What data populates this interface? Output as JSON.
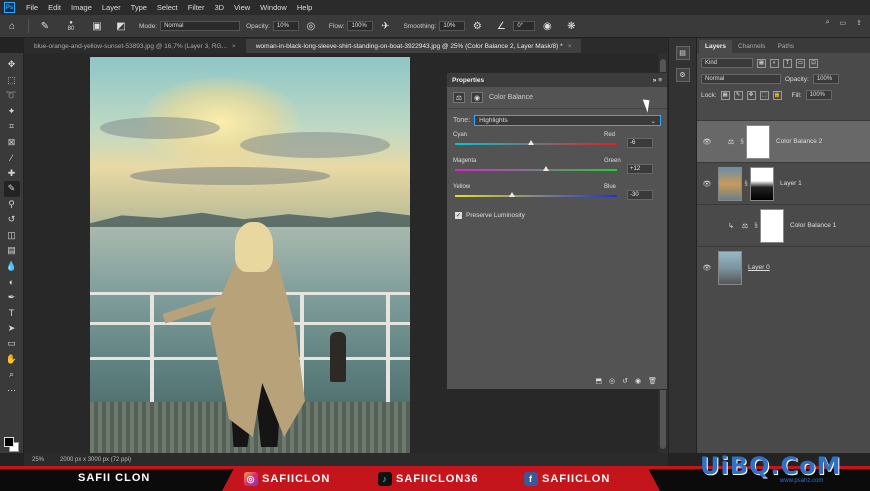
{
  "menu": [
    "File",
    "Edit",
    "Image",
    "Layer",
    "Type",
    "Select",
    "Filter",
    "3D",
    "View",
    "Window",
    "Help"
  ],
  "options": {
    "brush_size": "80",
    "mode_label": "Mode:",
    "mode_value": "Normal",
    "opacity_label": "Opacity:",
    "opacity_value": "10%",
    "flow_label": "Flow:",
    "flow_value": "100%",
    "smoothing_label": "Smoothing:",
    "smoothing_value": "10%",
    "angle_value": "0°"
  },
  "tabs": [
    {
      "label": "blue-orange-and-yellow-sunset-53893.jpg @ 16,7% (Layer 3, RG...",
      "active": false
    },
    {
      "label": "woman-in-black-long-sleeve-shirt-standing-on-boat-3922943.jpg @ 25% (Color Balance 2, Layer Mask/8) *",
      "active": true
    }
  ],
  "properties": {
    "panel_title": "Properties",
    "adjustment_name": "Color Balance",
    "tone_label": "Tone:",
    "tone_value": "Highlights",
    "sliders": [
      {
        "left": "Cyan",
        "right": "Red",
        "value": "-6",
        "position": 0.47
      },
      {
        "left": "Magenta",
        "right": "Green",
        "value": "+12",
        "position": 0.56
      },
      {
        "left": "Yellow",
        "right": "Blue",
        "value": "-30",
        "position": 0.35
      }
    ],
    "preserve_label": "Preserve Luminosity"
  },
  "layers_panel": {
    "tabs": [
      "Layers",
      "Channels",
      "Paths"
    ],
    "filter_value": "Kind",
    "blend_value": "Normal",
    "opacity_label": "Opacity:",
    "opacity_value": "100%",
    "lock_label": "Lock:",
    "fill_label": "Fill:",
    "fill_value": "100%",
    "layers": [
      {
        "name": "Color Balance 2",
        "selected": true
      },
      {
        "name": "Layer 1",
        "selected": false
      },
      {
        "name": "Color Balance 1",
        "selected": false
      },
      {
        "name": "Layer 0",
        "selected": false
      }
    ]
  },
  "status": {
    "zoom": "25%",
    "doc_info": "2000 px x 3000 px (72 ppi)"
  },
  "banner": {
    "name": "SAFII CLON",
    "instagram": "SAFIICLON",
    "tiktok": "SAFIICLON36",
    "facebook": "SAFIICLON",
    "colors": {
      "red": "#c4151c",
      "black": "#0b0b0b"
    }
  },
  "watermark": {
    "text": "UiBQ.CoM",
    "sub": "www.psahz.com"
  }
}
